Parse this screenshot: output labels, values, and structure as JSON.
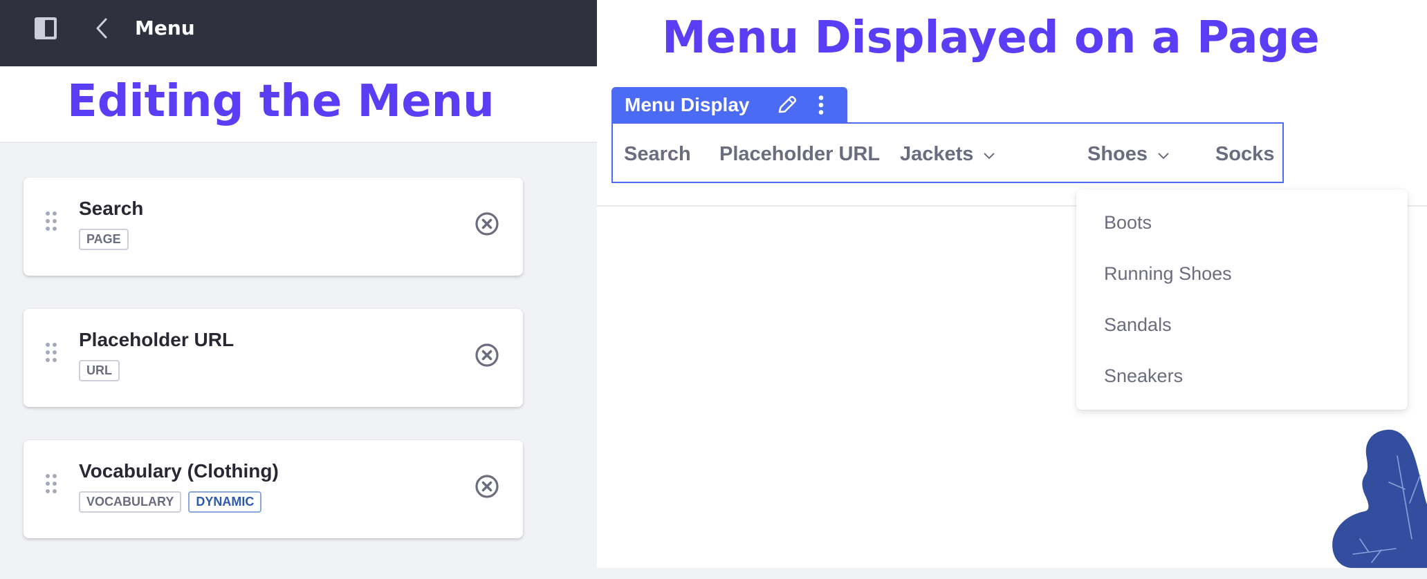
{
  "left_panel": {
    "topbar": {
      "title": "Menu",
      "icons": {
        "panel": "sidebar-panel-icon",
        "back": "chevron-left-icon"
      }
    },
    "heading": "Editing the Menu",
    "menu_items": [
      {
        "title": "Search",
        "badges": [
          {
            "label": "PAGE",
            "style": "secondary"
          }
        ]
      },
      {
        "title": "Placeholder URL",
        "badges": [
          {
            "label": "URL",
            "style": "secondary"
          }
        ]
      },
      {
        "title": "Vocabulary (Clothing)",
        "badges": [
          {
            "label": "VOCABULARY",
            "style": "secondary"
          },
          {
            "label": "DYNAMIC",
            "style": "info"
          }
        ]
      }
    ],
    "item_icons": {
      "drag": "drag-handle-icon",
      "remove": "times-circle-icon"
    }
  },
  "right_panel": {
    "heading": "Menu Displayed on a Page",
    "fragment": {
      "name": "Menu Display",
      "icons": {
        "edit": "pencil-icon",
        "options": "ellipsis-vertical-icon"
      }
    },
    "nav_items": [
      {
        "label": "Search",
        "has_dropdown": false
      },
      {
        "label": "Placeholder URL",
        "has_dropdown": false
      },
      {
        "label": "Jackets",
        "has_dropdown": true
      },
      {
        "label": "Shoes",
        "has_dropdown": true
      },
      {
        "label": "Socks",
        "has_dropdown": false
      }
    ],
    "open_dropdown": {
      "parent": "Shoes",
      "items": [
        "Boots",
        "Running Shoes",
        "Sandals",
        "Sneakers"
      ]
    }
  },
  "colors": {
    "heading": "#5a3ef5",
    "topbar": "#30313f",
    "fragment_accent": "#4b6bf5",
    "text_secondary": "#6b6c7e",
    "text_primary": "#272833",
    "leaf": "#334e9e"
  }
}
